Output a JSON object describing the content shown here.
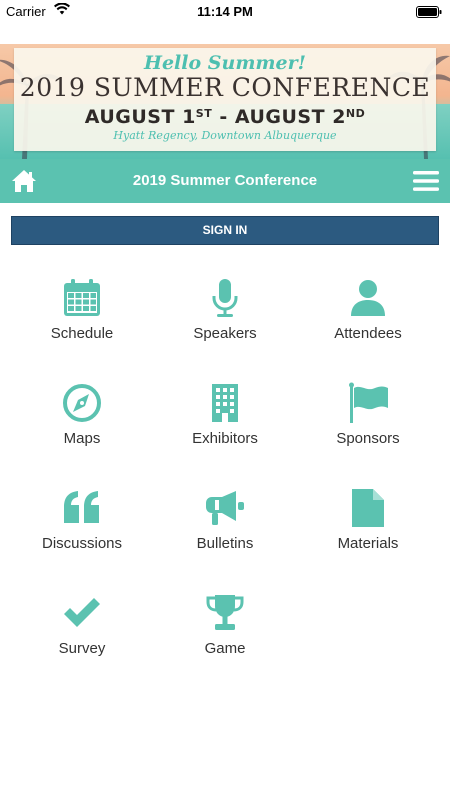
{
  "status_bar": {
    "carrier": "Carrier",
    "time": "11:14 PM"
  },
  "banner": {
    "hello": "Hello Summer!",
    "conference": "2019 SUMMER CONFERENCE",
    "dates_part1": "AUGUST 1",
    "dates_sup1": "ST",
    "dates_sep": " - ",
    "dates_part2": "AUGUST 2",
    "dates_sup2": "ND",
    "venue": "Hyatt Regency, Downtown Albuquerque"
  },
  "navbar": {
    "title": "2019 Summer Conference"
  },
  "signin": {
    "label": "SIGN IN"
  },
  "menu": [
    {
      "label": "Schedule",
      "icon": "calendar-icon"
    },
    {
      "label": "Speakers",
      "icon": "microphone-icon"
    },
    {
      "label": "Attendees",
      "icon": "person-icon"
    },
    {
      "label": "Maps",
      "icon": "compass-icon"
    },
    {
      "label": "Exhibitors",
      "icon": "building-icon"
    },
    {
      "label": "Sponsors",
      "icon": "flag-icon"
    },
    {
      "label": "Discussions",
      "icon": "quote-icon"
    },
    {
      "label": "Bulletins",
      "icon": "megaphone-icon"
    },
    {
      "label": "Materials",
      "icon": "document-icon"
    },
    {
      "label": "Survey",
      "icon": "checkmark-icon"
    },
    {
      "label": "Game",
      "icon": "trophy-icon"
    }
  ],
  "colors": {
    "accent": "#5bc2b0",
    "signin": "#2c5a80",
    "icon": "#5bc2b0"
  }
}
